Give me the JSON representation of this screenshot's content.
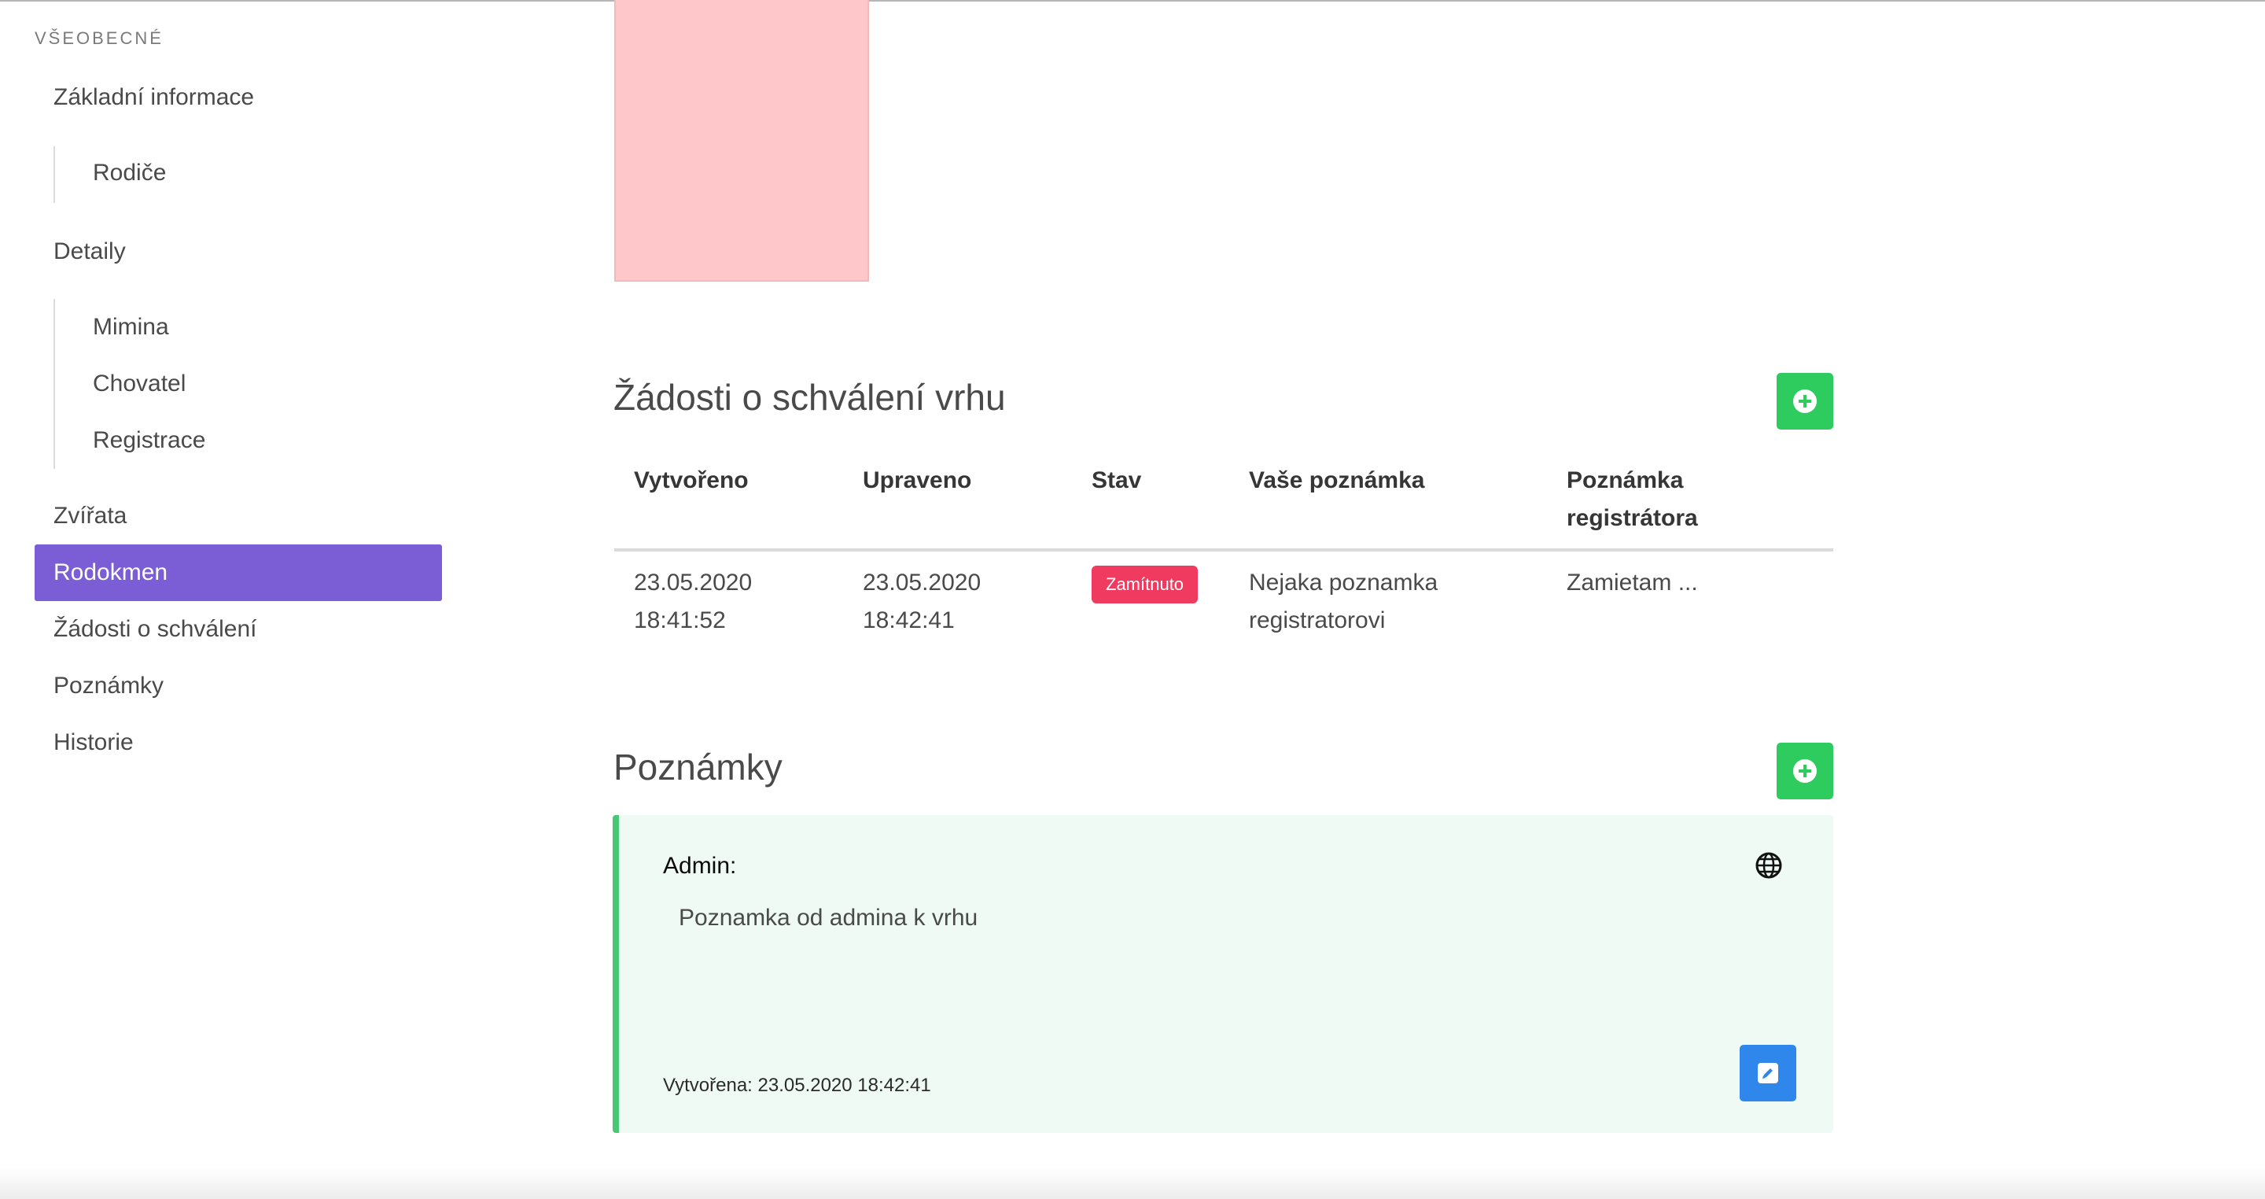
{
  "sidebar": {
    "section_label": "VŠEOBECNÉ",
    "items": [
      {
        "label": "Základní informace"
      },
      {
        "label": "Rodiče"
      },
      {
        "label": "Detaily"
      },
      {
        "label": "Mimina"
      },
      {
        "label": "Chovatel"
      },
      {
        "label": "Registrace"
      },
      {
        "label": "Zvířata"
      },
      {
        "label": "Rodokmen",
        "active": true
      },
      {
        "label": "Žádosti o schválení"
      },
      {
        "label": "Poznámky"
      },
      {
        "label": "Historie"
      }
    ]
  },
  "requests": {
    "title": "Žádosti o schválení vrhu",
    "headers": [
      "Vytvořeno",
      "Upraveno",
      "Stav",
      "Vaše poznámka",
      "Poznámka registrátora"
    ],
    "header_lines": {
      "h4_line1": "Poznámka",
      "h4_line2": "registrátora"
    },
    "rows": [
      {
        "created_date": "23.05.2020",
        "created_time": "18:41:52",
        "updated_date": "23.05.2020",
        "updated_time": "18:42:41",
        "status": "Zamítnuto",
        "your_note_line1": "Nejaka poznamka",
        "your_note_line2": "registratorovi",
        "registrar_note": "Zamietam ..."
      }
    ]
  },
  "notes": {
    "title": "Poznámky",
    "items": [
      {
        "author": "Admin:",
        "text": "Poznamka od admina k vrhu",
        "created": "Vytvořena: 23.05.2020 18:42:41"
      }
    ]
  },
  "colors": {
    "accent": "#7b5ed6",
    "success": "#2ecc5f",
    "danger": "#f03a5f",
    "info": "#2f86eb",
    "note_bg": "#effaf5",
    "photo_placeholder": "#fec7c9"
  },
  "icons": {
    "add": "plus-circle-icon",
    "globe": "globe-icon",
    "edit": "edit-icon"
  }
}
